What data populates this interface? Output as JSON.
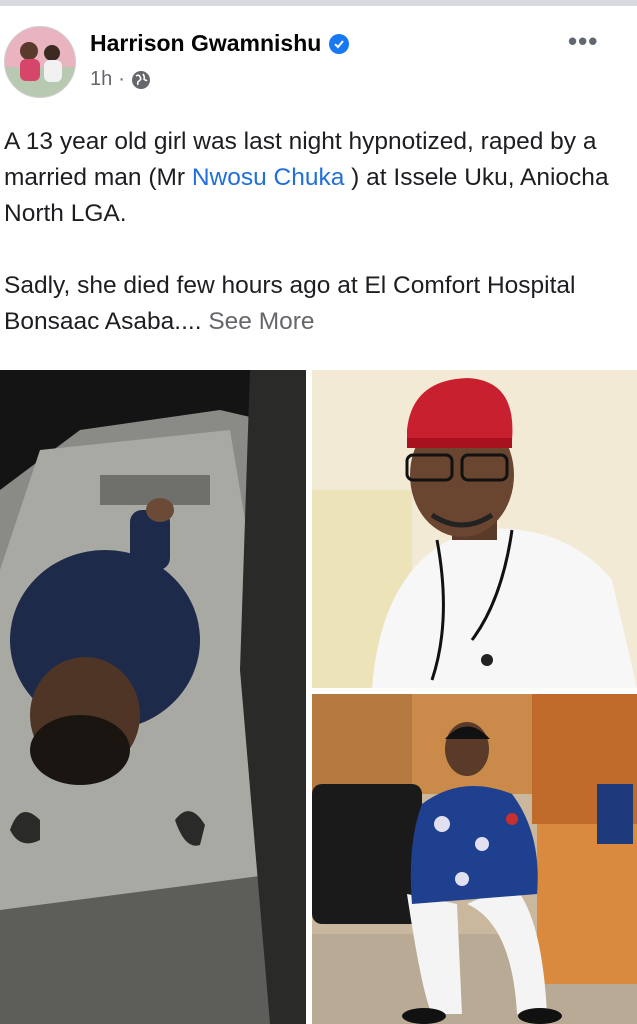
{
  "post": {
    "author": "Harrison Gwamnishu",
    "time": "1h",
    "separator": "·",
    "text_p1_before": "A 13 year old girl was last night hypnotized, raped by a married man (Mr ",
    "tagged_name": "Nwosu Chuka",
    "text_p1_after": " ) at Issele Uku, Aniocha North LGA.",
    "text_p2": "Sadly, she died few hours ago at El Comfort Hospital Bonsaac Asaba....",
    "see_more": "See More"
  },
  "icons": {
    "verified": "verified-badge-icon",
    "audience": "globe-icon",
    "more": "more-options-icon"
  },
  "colors": {
    "link": "#216fdb",
    "verified": "#1877f2",
    "meta": "#65676b"
  }
}
